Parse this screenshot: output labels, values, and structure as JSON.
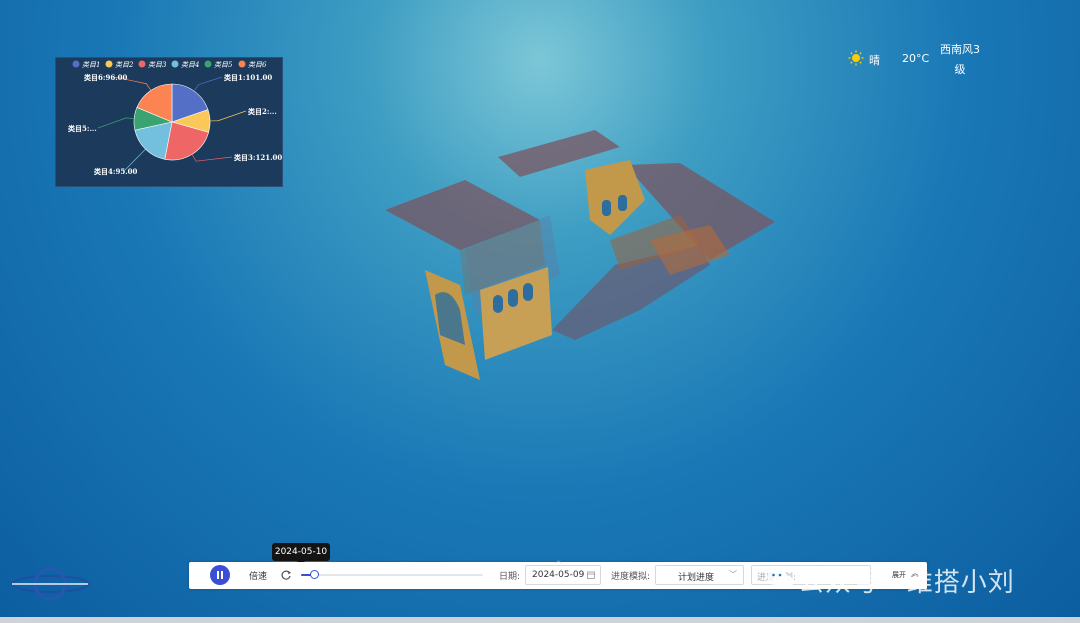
{
  "weather": {
    "icon": "sun-icon",
    "condition": "晴",
    "temperature": "20°C",
    "wind_line1": "西南风3",
    "wind_line2": "级"
  },
  "chart_data": {
    "type": "pie",
    "legend": [
      "类目1",
      "类目2",
      "类目3",
      "类目4",
      "类目5",
      "类目6"
    ],
    "colors": [
      "#5470c6",
      "#fac858",
      "#ee6666",
      "#73c0de",
      "#3ba272",
      "#fc8452"
    ],
    "values": [
      101,
      0,
      121,
      95,
      0,
      96
    ],
    "labels": [
      "类目1:101.00",
      "类目2:...",
      "类目3:121.00",
      "类目4:95.00",
      "类目5:...",
      "类目6:96.00"
    ],
    "legend_position": "top"
  },
  "toolbar": {
    "speed_label": "倍速",
    "tooltip_date": "2024-05-10",
    "progress": 0.07,
    "date_label": "日期:",
    "date_value": "2024-05-09",
    "sim_label": "进度模拟:",
    "sim_value": "计划进度",
    "plan_label": "进度计划:",
    "expand_label": "展开",
    "accent": "#3a4fd6"
  },
  "watermark": {
    "text": "公众号 · 维搭小刘"
  }
}
